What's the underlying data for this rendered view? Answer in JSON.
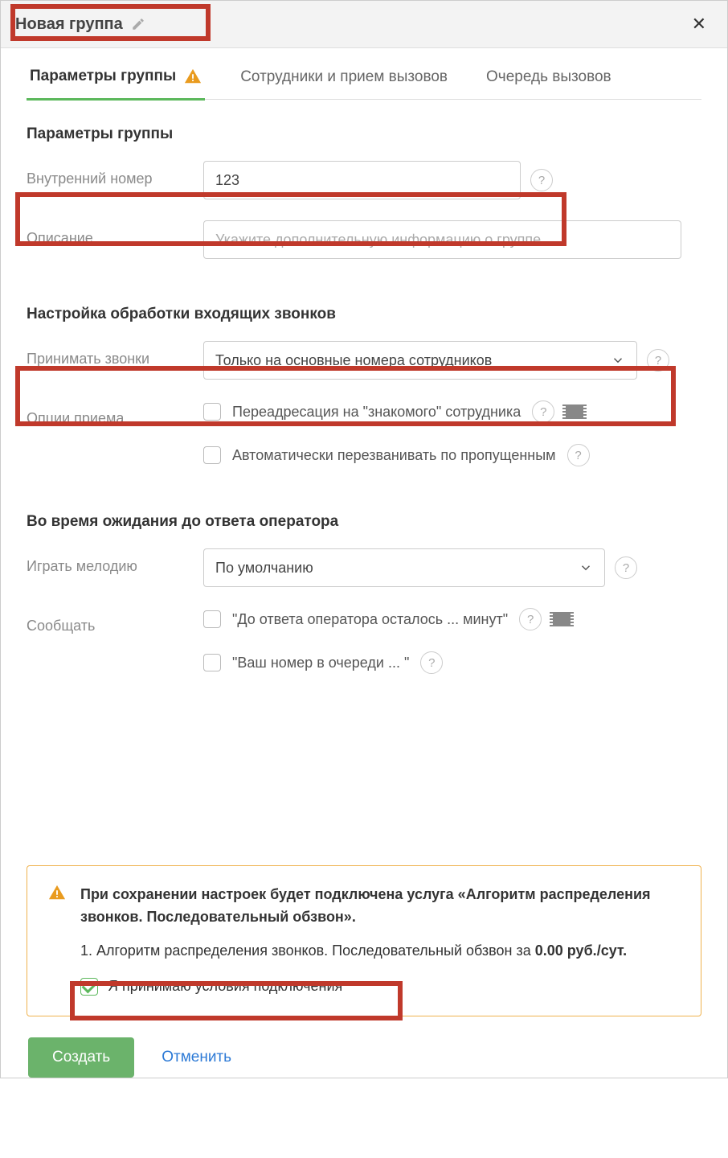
{
  "header": {
    "title": "Новая группа"
  },
  "tabs": [
    {
      "label": "Параметры группы",
      "active": true,
      "warn": true
    },
    {
      "label": "Сотрудники и прием вызовов",
      "active": false
    },
    {
      "label": "Очередь вызовов",
      "active": false
    }
  ],
  "sections": {
    "group_params": {
      "title": "Параметры группы",
      "internal_number": {
        "label": "Внутренний номер",
        "value": "123"
      },
      "description": {
        "label": "Описание",
        "placeholder": "Укажите дополнительную информацию о группе"
      }
    },
    "incoming": {
      "title": "Настройка обработки входящих звонков",
      "accept": {
        "label": "Принимать звонки",
        "value": "Только на основные номера сотрудников"
      },
      "options_label": "Опции приема",
      "opt_forward": {
        "label": "Переадресация на \"знакомого\" сотрудника",
        "checked": false
      },
      "opt_callback": {
        "label": "Автоматически перезванивать по пропущенным",
        "checked": false
      }
    },
    "hold": {
      "title": "Во время ожидания до ответа оператора",
      "melody": {
        "label": "Играть мелодию",
        "value": "По умолчанию"
      },
      "announce_label": "Сообщать",
      "announce_eta": {
        "label": "\"До ответа оператора осталось ... минут\"",
        "checked": false
      },
      "announce_queue": {
        "label": "\"Ваш номер в очереди ... \"",
        "checked": false
      }
    }
  },
  "notice": {
    "title": "При сохранении настроек будет подключена услуга «Алгоритм распределения звонков. Последовательный обзвон».",
    "line1_prefix": "1. Алгоритм распределения звонков. Последовательный обзвон за ",
    "line1_price": "0.00 руб./сут.",
    "accept": {
      "label": "Я принимаю условия подключения",
      "checked": true
    }
  },
  "footer": {
    "create": "Создать",
    "cancel": "Отменить"
  }
}
